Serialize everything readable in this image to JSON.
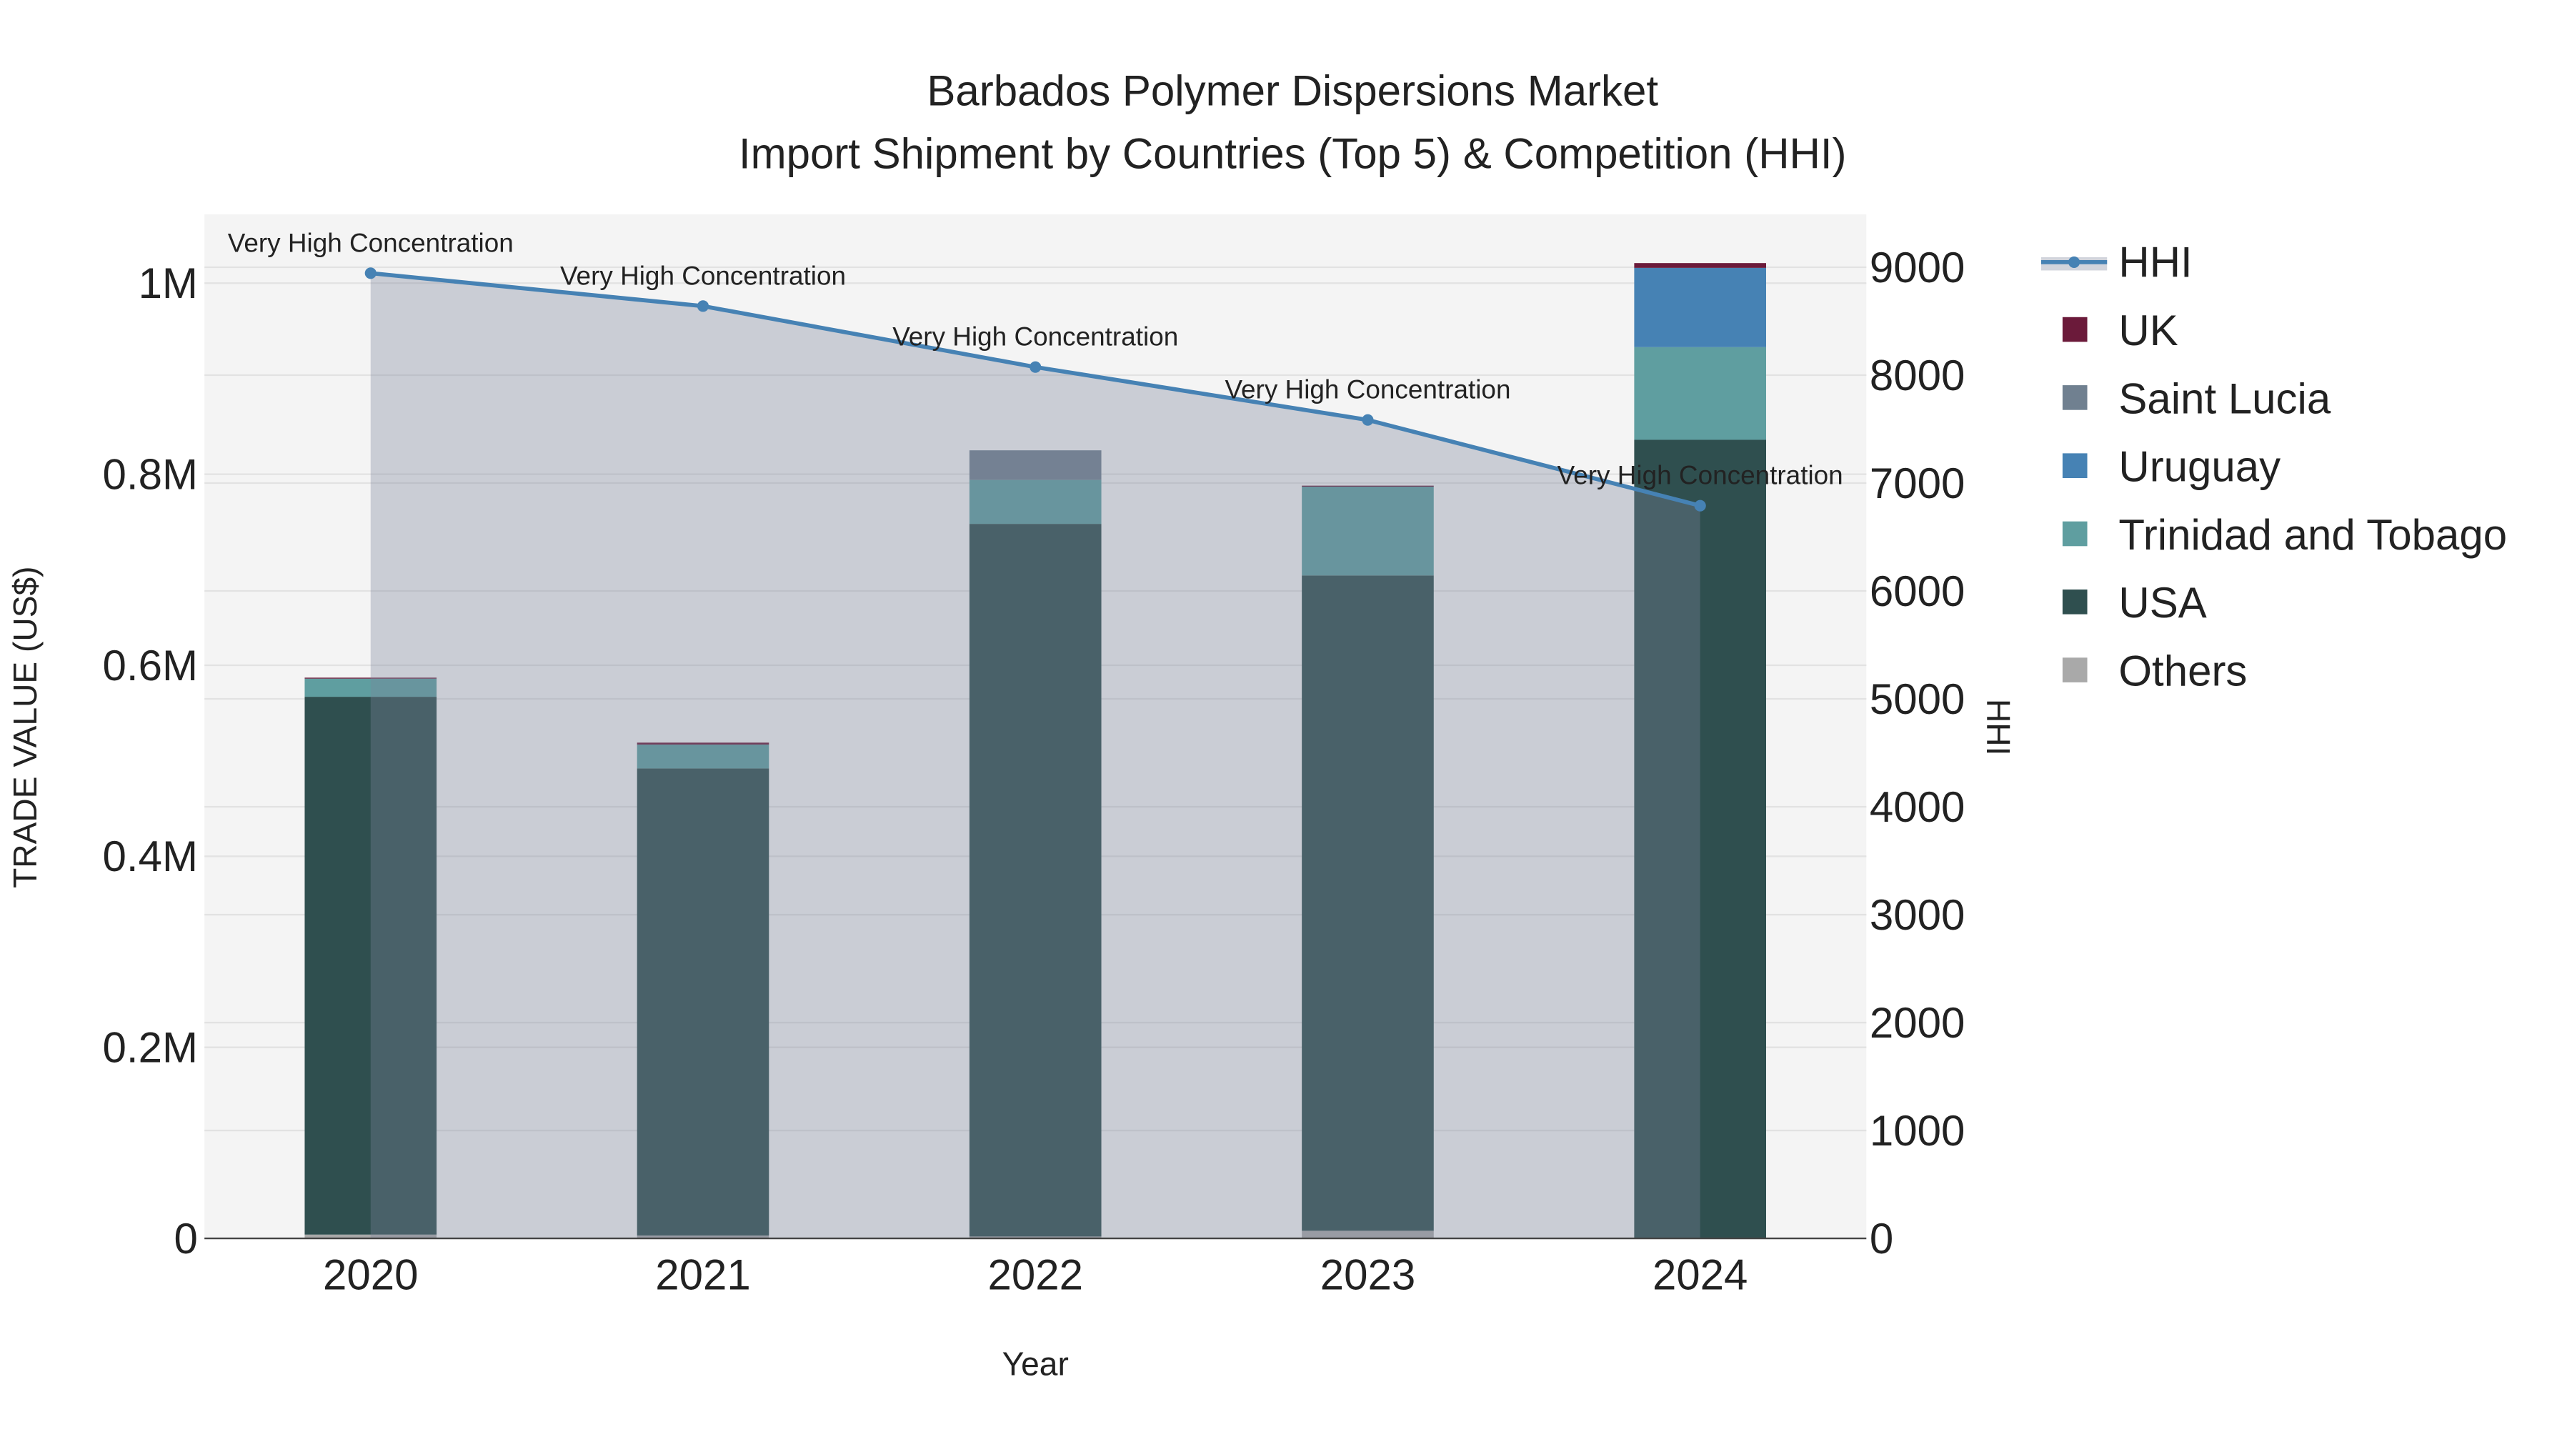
{
  "chart_data": {
    "type": "bar",
    "title": "Barbados Polymer Dispersions Market",
    "subtitle": "Import Shipment by Countries (Top 5) & Competition (HHI)",
    "xlabel": "Year",
    "ylabel": "TRADE VALUE (US$)",
    "y2label": "HHI",
    "categories": [
      "2020",
      "2021",
      "2022",
      "2023",
      "2024"
    ],
    "ylim": [
      0,
      1072000
    ],
    "y2lim": [
      0,
      9490
    ],
    "yticks": [
      0,
      200000,
      400000,
      600000,
      800000,
      1000000
    ],
    "ytick_labels": [
      "0",
      "0.2M",
      "0.4M",
      "0.6M",
      "0.8M",
      "1M"
    ],
    "y2ticks": [
      0,
      1000,
      2000,
      3000,
      4000,
      5000,
      6000,
      7000,
      8000,
      9000
    ],
    "y2tick_labels": [
      "0",
      "1000",
      "2000",
      "3000",
      "4000",
      "5000",
      "6000",
      "7000",
      "8000",
      "9000"
    ],
    "grid": true,
    "legend_position": "right",
    "series": [
      {
        "name": "Others",
        "color": "#a9a9a9",
        "values": [
          4000,
          3000,
          2000,
          8000,
          0
        ]
      },
      {
        "name": "USA",
        "color": "#2f4f4f",
        "values": [
          563000,
          489000,
          746000,
          686000,
          836000
        ]
      },
      {
        "name": "Trinidad and Tobago",
        "color": "#5f9ea0",
        "values": [
          19000,
          25000,
          46000,
          93000,
          97000
        ]
      },
      {
        "name": "Uruguay",
        "color": "#4682b4",
        "values": [
          0,
          0,
          0,
          0,
          83000
        ]
      },
      {
        "name": "Saint Lucia",
        "color": "#708090",
        "values": [
          0,
          0,
          31000,
          0,
          0
        ]
      },
      {
        "name": "UK",
        "color": "#6b1a3a",
        "values": [
          1000,
          2000,
          0,
          1000,
          5000
        ]
      }
    ],
    "line": {
      "name": "HHI",
      "color": "#4682b4",
      "values": [
        8945,
        8640,
        8075,
        7585,
        6790
      ],
      "annotations": [
        "Very High Concentration",
        "Very High Concentration",
        "Very High Concentration",
        "Very High Concentration",
        "Very High Concentration"
      ]
    },
    "legend": [
      "HHI",
      "UK",
      "Saint Lucia",
      "Uruguay",
      "Trinidad and Tobago",
      "USA",
      "Others"
    ]
  }
}
